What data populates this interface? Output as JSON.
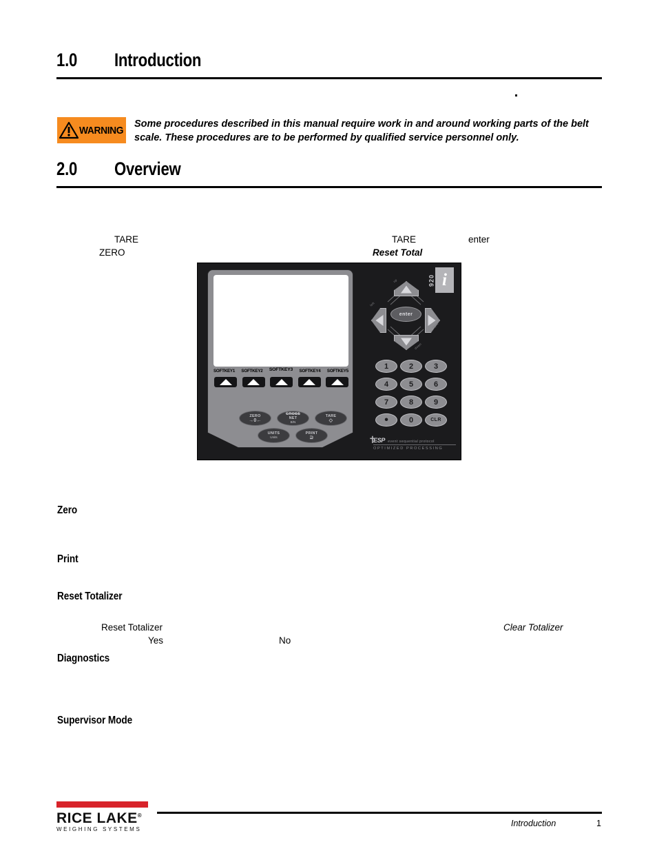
{
  "document": {
    "sections": [
      {
        "number": "1.0",
        "title": "Introduction"
      },
      {
        "number": "2.0",
        "title": "Overview"
      }
    ],
    "warning": {
      "badge_label": "WARNING",
      "badge_color": "#F68B1F",
      "text": "Some procedures described in this manual require work in and around working parts of the belt scale. These procedures are to be performed by qualified service personnel only."
    },
    "overview_fragments": {
      "tare_left": "TARE",
      "zero_left": "ZERO",
      "tare_right": "TARE",
      "enter": "enter",
      "reset_total": "Reset Total"
    },
    "subheadings": [
      {
        "label": "Zero"
      },
      {
        "label": "Print"
      },
      {
        "label": "Reset Totalizer"
      },
      {
        "label": "Diagnostics"
      },
      {
        "label": "Supervisor Mode"
      }
    ],
    "reset_totalizer_fragments": {
      "reset_totalizer": "Reset Totalizer",
      "clear_totalizer": "Clear Totalizer",
      "yes": "Yes",
      "no": "No"
    }
  },
  "device": {
    "model_digits": "920",
    "model_letter": "i",
    "softkeys": [
      "SOFTKEY1",
      "SOFTKEY2",
      "SOFTKEY3",
      "SOFTKEY4",
      "SOFTKEY5"
    ],
    "function_keys": [
      {
        "name": "ZERO",
        "sub": "",
        "glyph": "→0←"
      },
      {
        "name": "GROSS",
        "sub": "NET",
        "glyph": "B/N"
      },
      {
        "name": "TARE",
        "sub": "",
        "glyph": "◇"
      },
      {
        "name": "UNITS",
        "sub": "Units",
        "glyph": ""
      },
      {
        "name": "PRINT",
        "sub": "",
        "glyph": "⊇"
      }
    ],
    "numeric_keys": [
      "1",
      "2",
      "3",
      "4",
      "5",
      "6",
      "7",
      "8",
      "9",
      "•",
      "0",
      "CLR"
    ],
    "enter_label": "enter",
    "nav_captions": {
      "up": "up",
      "down": "down",
      "left": "left",
      "right": "right"
    },
    "esp_logo": {
      "mark": "ESP",
      "expansion": "event sequential protocol",
      "tagline": "OPTIMIZED PROCESSING"
    }
  },
  "footer": {
    "brand_name": "RICE LAKE",
    "brand_trademark": "®",
    "brand_tagline": "WEIGHING SYSTEMS",
    "brand_bar_color": "#D8232A",
    "section": "Introduction",
    "page_number": "1"
  }
}
